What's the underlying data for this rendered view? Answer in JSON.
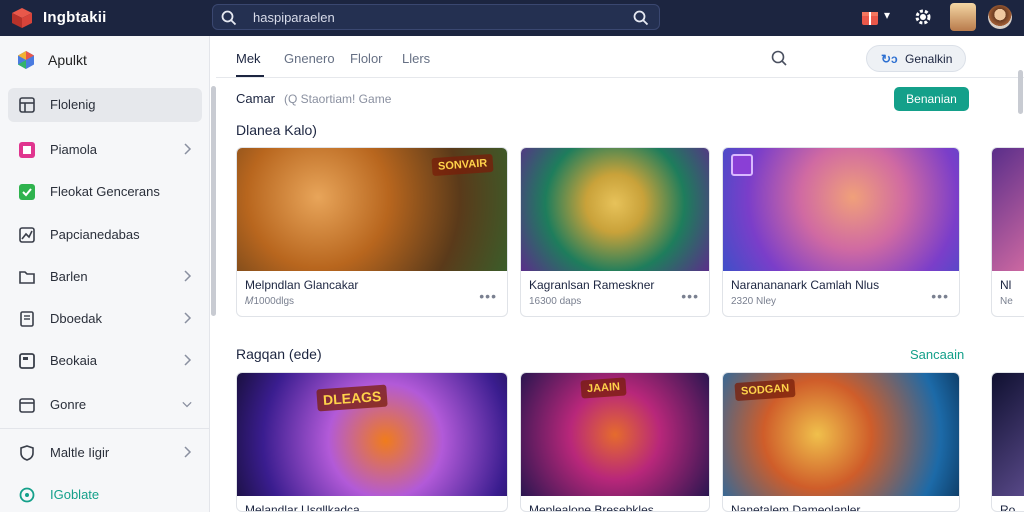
{
  "app": {
    "name": "Ingbtakii"
  },
  "search": {
    "value": "haspiparaelen"
  },
  "sidebar": {
    "brand": "Apulkt",
    "items": [
      {
        "label": "Flolenig",
        "active": true,
        "chevron": false,
        "icon": "grid-icon"
      },
      {
        "label": "Piamola",
        "active": false,
        "chevron": true,
        "icon": "pink-square-icon"
      },
      {
        "label": "Fleokat Gencerans",
        "active": false,
        "chevron": false,
        "icon": "green-square-icon"
      },
      {
        "label": "Papcianedabas",
        "active": false,
        "chevron": false,
        "icon": "chart-icon"
      },
      {
        "label": "Barlen",
        "active": false,
        "chevron": true,
        "icon": "folder-icon"
      },
      {
        "label": "Dboedak",
        "active": false,
        "chevron": true,
        "icon": "book-icon"
      },
      {
        "label": "Beokaia",
        "active": false,
        "chevron": true,
        "icon": "doc-icon"
      },
      {
        "label": "Gonre",
        "active": false,
        "chevron": true,
        "icon": "calendar-icon"
      },
      {
        "label": "Maltle Iigir",
        "active": false,
        "chevron": true,
        "icon": "shield-icon"
      },
      {
        "label": "IGoblate",
        "active": false,
        "chevron": false,
        "icon": "globe-icon"
      }
    ]
  },
  "tabs": [
    {
      "label": "Mek",
      "active": true
    },
    {
      "label": "Gnenero",
      "active": false
    },
    {
      "label": "Flolor",
      "active": false
    },
    {
      "label": "Llers",
      "active": false
    }
  ],
  "top_button": {
    "icon_text": "↻ↄ",
    "label": "Genalkin"
  },
  "crumb": {
    "label": "Camar",
    "hint": "(Q Staortiam! Game"
  },
  "action_button": "Benanian",
  "section1": {
    "title": "Dlanea Kalo)",
    "cards": [
      {
        "title": "Melpndlan Glancakar",
        "meta": "𝑀1000dlgs",
        "badge": "SONVAIR",
        "colors": [
          "#b8661e",
          "#5a3a1a",
          "#3b5d2a"
        ]
      },
      {
        "title": "Kagranlsan Rameskner",
        "meta": "16300 daps",
        "badge": "",
        "colors": [
          "#1e7d5c",
          "#c9a23a",
          "#5a2e8a"
        ]
      },
      {
        "title": "Naranananark Camlah Nlus",
        "meta": "2320 Nley",
        "badge": "",
        "colors": [
          "#3f4fc8",
          "#d06aa2",
          "#7b3ec9"
        ],
        "sticker": true
      }
    ],
    "peek": {
      "title": "Nl",
      "meta": "Ne"
    }
  },
  "section2": {
    "title": "Ragqan (ede)",
    "link": "Sancaain",
    "cards": [
      {
        "title": "Melandlar Usgllkadca",
        "meta": "",
        "badge": "DLEAGS",
        "colors": [
          "#3a1d8f",
          "#b25ad8",
          "#f07c1c"
        ]
      },
      {
        "title": "Meplealone Bresebkles",
        "meta": "",
        "badge": "JAAIN",
        "colors": [
          "#2a1650",
          "#b8277a",
          "#e56b2d"
        ]
      },
      {
        "title": "Nanetalem Dameolanler",
        "meta": "",
        "badge": "SODGAN",
        "colors": [
          "#1c6aa8",
          "#cf5d2a",
          "#f0c04c"
        ]
      }
    ],
    "peek": {
      "title": "Ro"
    }
  }
}
